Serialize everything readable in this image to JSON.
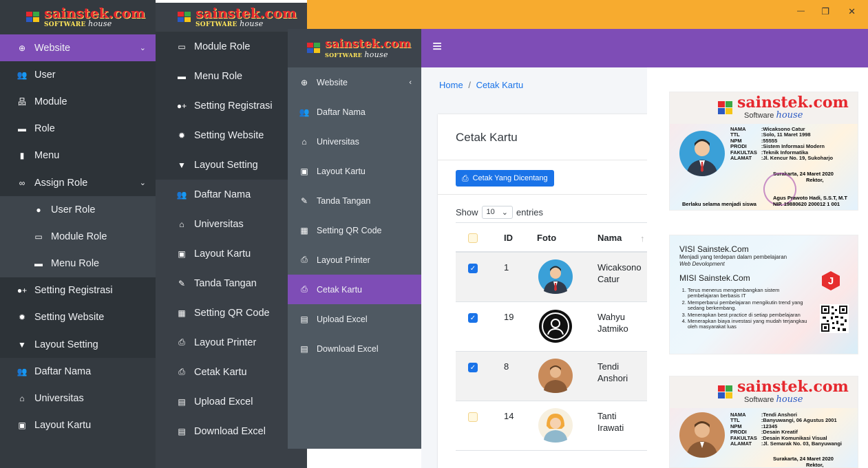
{
  "panel1": {
    "logo": {
      "brand": "sainstek",
      "tld": ".com",
      "sub1": "SOFTWARE",
      "sub2": "house"
    },
    "items": [
      {
        "label": "Website",
        "icon": "globe-icon",
        "glyph": "⊕",
        "chevron": "⌄",
        "active": true
      },
      {
        "label": "User",
        "icon": "users-icon",
        "glyph": "👥"
      },
      {
        "label": "Module",
        "icon": "sitemap-icon",
        "glyph": "品"
      },
      {
        "label": "Role",
        "icon": "briefcase-icon",
        "glyph": "▬"
      },
      {
        "label": "Menu",
        "icon": "book-icon",
        "glyph": "▮"
      },
      {
        "label": "Assign Role",
        "icon": "link-icon",
        "glyph": "∞",
        "chevron": "⌄"
      },
      {
        "label": "User Role",
        "icon": "user-icon",
        "glyph": "●",
        "sub": true
      },
      {
        "label": "Module Role",
        "icon": "monitor-icon",
        "glyph": "▭",
        "sub": true
      },
      {
        "label": "Menu Role",
        "icon": "folder-icon",
        "glyph": "▬",
        "sub": true
      },
      {
        "label": "Setting Registrasi",
        "icon": "user-plus-icon",
        "glyph": "●+"
      },
      {
        "label": "Setting Website",
        "icon": "gear-icon",
        "glyph": "✹"
      },
      {
        "label": "Layout Setting",
        "icon": "pin-icon",
        "glyph": "▼"
      },
      {
        "label": "Daftar Nama",
        "icon": "users-icon",
        "glyph": "👥"
      },
      {
        "label": "Universitas",
        "icon": "university-icon",
        "glyph": "⌂"
      },
      {
        "label": "Layout Kartu",
        "icon": "id-card-icon",
        "glyph": "▣"
      }
    ]
  },
  "panel2": {
    "logo": {
      "brand": "sainstek",
      "tld": ".com",
      "sub1": "SOFTWARE",
      "sub2": "house"
    },
    "items": [
      {
        "label": "Module Role",
        "icon": "monitor-icon",
        "glyph": "▭"
      },
      {
        "label": "Menu Role",
        "icon": "folder-icon",
        "glyph": "▬"
      },
      {
        "label": "Setting Registrasi",
        "icon": "user-plus-icon",
        "glyph": "●+"
      },
      {
        "label": "Setting Website",
        "icon": "gear-icon",
        "glyph": "✹"
      },
      {
        "label": "Layout Setting",
        "icon": "pin-icon",
        "glyph": "▼"
      },
      {
        "label": "Daftar Nama",
        "icon": "users-icon",
        "glyph": "👥"
      },
      {
        "label": "Universitas",
        "icon": "university-icon",
        "glyph": "⌂"
      },
      {
        "label": "Layout Kartu",
        "icon": "id-card-icon",
        "glyph": "▣"
      },
      {
        "label": "Tanda Tangan",
        "icon": "signature-icon",
        "glyph": "✎"
      },
      {
        "label": "Setting QR Code",
        "icon": "qrcode-icon",
        "glyph": "▦"
      },
      {
        "label": "Layout Printer",
        "icon": "printer-icon",
        "glyph": "⎙"
      },
      {
        "label": "Cetak Kartu",
        "icon": "printer-icon",
        "glyph": "⎙"
      },
      {
        "label": "Upload Excel",
        "icon": "file-excel-icon",
        "glyph": "▤"
      },
      {
        "label": "Download Excel",
        "icon": "file-excel-icon",
        "glyph": "▤"
      }
    ]
  },
  "panel3": {
    "logo": {
      "brand": "sainstek",
      "tld": ".com",
      "sub1": "SOFTWARE",
      "sub2": "house"
    },
    "items": [
      {
        "label": "Website",
        "icon": "globe-icon",
        "glyph": "⊕",
        "chevron": "‹"
      },
      {
        "label": "Daftar Nama",
        "icon": "users-icon",
        "glyph": "👥"
      },
      {
        "label": "Universitas",
        "icon": "university-icon",
        "glyph": "⌂"
      },
      {
        "label": "Layout Kartu",
        "icon": "id-card-icon",
        "glyph": "▣"
      },
      {
        "label": "Tanda Tangan",
        "icon": "signature-icon",
        "glyph": "✎"
      },
      {
        "label": "Setting QR Code",
        "icon": "qrcode-icon",
        "glyph": "▦"
      },
      {
        "label": "Layout Printer",
        "icon": "printer-icon",
        "glyph": "⎙"
      },
      {
        "label": "Cetak Kartu",
        "icon": "printer-icon",
        "glyph": "⎙",
        "active": true
      },
      {
        "label": "Upload Excel",
        "icon": "file-excel-icon",
        "glyph": "▤"
      },
      {
        "label": "Download Excel",
        "icon": "file-excel-icon",
        "glyph": "▤"
      }
    ]
  },
  "titlebar": {
    "minimize": "—",
    "maximize": "❐",
    "close": "✕"
  },
  "topbar": {
    "hamburger": "≡"
  },
  "breadcrumb": {
    "home": "Home",
    "sep": "/",
    "current": "Cetak Kartu"
  },
  "content": {
    "heading": "Cetak Kartu",
    "print_button": "Cetak Yang Dicentang",
    "show": "Show",
    "entries_value": "10",
    "entries": "entries",
    "columns": {
      "id": "ID",
      "foto": "Foto",
      "nama": "Nama",
      "sort": "↑"
    },
    "rows": [
      {
        "checked": true,
        "id": "1",
        "nama1": "Wicaksono",
        "nama2": "Catur",
        "avatar": "male-suit"
      },
      {
        "checked": true,
        "id": "19",
        "nama1": "Wahyu",
        "nama2": "Jatmiko",
        "avatar": "default"
      },
      {
        "checked": true,
        "id": "8",
        "nama1": "Tendi",
        "nama2": "Anshori",
        "avatar": "male-brown"
      },
      {
        "checked": false,
        "id": "14",
        "nama1": "Tanti",
        "nama2": "Irawati",
        "avatar": "female"
      }
    ]
  },
  "cards": {
    "front1": {
      "brand": "sainstek",
      "tld": ".com",
      "sub1": "Software",
      "sub2": "house",
      "labels": [
        "NAMA",
        "TTL",
        "NPM",
        "PRODI",
        "FAKULTAS",
        "ALAMAT"
      ],
      "values": [
        ":Wicaksono Catur",
        ":Solo, 11 Maret 1998",
        ":55555",
        ":Sistem Informasi Modern",
        ":Teknik Informatika",
        ":Jl. Kencur No. 19, Sukoharjo"
      ],
      "place_date": "Surakarta, 24 Maret 2020",
      "role": "Rektor,",
      "signer": "Agus Prawoto Hadi, S.S.T, M.T",
      "nip": "NIP. 19880620 200012 1 001",
      "validity": "Berlaku selama menjadi siswa"
    },
    "back": {
      "visi_title": "VISI Sainstek.Com",
      "visi_text": "Menjadi yang terdepan dalam pembelajaran",
      "visi_em": "Web Devolopment",
      "misi_title": "MISI Sainstek.Com",
      "misi": [
        "Terus menerus mengembangkan sistem pembelajaran berbasis IT",
        "Memperbarui pembelajaran mengikutin trend yang sedang berkembang.",
        "Menerapkan best practice di setiap pembelajaran",
        "Menerapkan biaya investasi yang mudah terjangkau oleh masyarakat luas"
      ],
      "badge": "J"
    },
    "front2": {
      "brand": "sainstek",
      "tld": ".com",
      "sub1": "Software",
      "sub2": "house",
      "labels": [
        "NAMA",
        "TTL",
        "NPM",
        "PRODI",
        "FAKULTAS",
        "ALAMAT"
      ],
      "values": [
        ":Tendi Anshori",
        ":Banyuwangi, 06 Agustus 2001",
        ":12345",
        ":Desain Kreatif",
        ":Desain Komunikasi Visual",
        ":Jl. Semarak No. 03, Banyuwangi"
      ],
      "place_date": "Surakarta, 24 Maret 2020",
      "role": "Rektor,"
    }
  },
  "colors": {
    "sidebar": "#343a40",
    "sidebar_alt": "#4f5962",
    "accent": "#7e4db6",
    "titlebar": "#f7ab2f",
    "primary": "#1a73e8"
  }
}
